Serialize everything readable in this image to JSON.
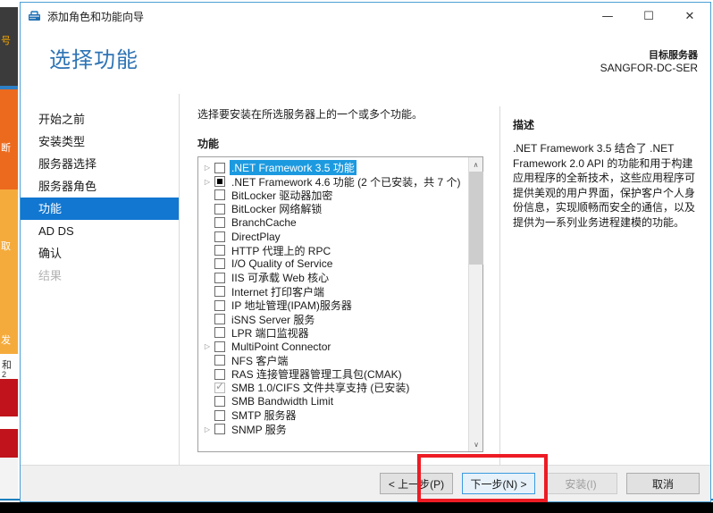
{
  "window": {
    "title": "添加角色和功能向导",
    "icon": "server-wizard-icon",
    "minimize": "—",
    "maximize": "☐",
    "close": "✕"
  },
  "header": {
    "page_title": "选择功能",
    "target_label": "目标服务器",
    "target_name": "SANGFOR-DC-SER"
  },
  "nav": {
    "items": [
      {
        "label": "开始之前",
        "state": "normal"
      },
      {
        "label": "安装类型",
        "state": "normal"
      },
      {
        "label": "服务器选择",
        "state": "normal"
      },
      {
        "label": "服务器角色",
        "state": "normal"
      },
      {
        "label": "功能",
        "state": "selected"
      },
      {
        "label": "AD DS",
        "state": "normal"
      },
      {
        "label": "确认",
        "state": "normal"
      },
      {
        "label": "结果",
        "state": "disabled"
      }
    ]
  },
  "main": {
    "instruction": "选择要安装在所选服务器上的一个或多个功能。",
    "features_label": "功能",
    "features": [
      {
        "label": ".NET Framework 3.5 功能",
        "checkbox": "unchecked",
        "expander": true,
        "selected": true
      },
      {
        "label": ".NET Framework 4.6 功能 (2 个已安装，共 7 个)",
        "checkbox": "partial",
        "expander": true,
        "selected": false
      },
      {
        "label": "BitLocker 驱动器加密",
        "checkbox": "unchecked",
        "expander": false,
        "selected": false
      },
      {
        "label": "BitLocker 网络解锁",
        "checkbox": "unchecked",
        "expander": false,
        "selected": false
      },
      {
        "label": "BranchCache",
        "checkbox": "unchecked",
        "expander": false,
        "selected": false
      },
      {
        "label": "DirectPlay",
        "checkbox": "unchecked",
        "expander": false,
        "selected": false
      },
      {
        "label": "HTTP 代理上的 RPC",
        "checkbox": "unchecked",
        "expander": false,
        "selected": false
      },
      {
        "label": "I/O Quality of Service",
        "checkbox": "unchecked",
        "expander": false,
        "selected": false
      },
      {
        "label": "IIS 可承载 Web 核心",
        "checkbox": "unchecked",
        "expander": false,
        "selected": false
      },
      {
        "label": "Internet 打印客户端",
        "checkbox": "unchecked",
        "expander": false,
        "selected": false
      },
      {
        "label": "IP 地址管理(IPAM)服务器",
        "checkbox": "unchecked",
        "expander": false,
        "selected": false
      },
      {
        "label": "iSNS Server 服务",
        "checkbox": "unchecked",
        "expander": false,
        "selected": false
      },
      {
        "label": "LPR 端口监视器",
        "checkbox": "unchecked",
        "expander": false,
        "selected": false
      },
      {
        "label": "MultiPoint Connector",
        "checkbox": "unchecked",
        "expander": true,
        "selected": false
      },
      {
        "label": "NFS 客户端",
        "checkbox": "unchecked",
        "expander": false,
        "selected": false
      },
      {
        "label": "RAS 连接管理器管理工具包(CMAK)",
        "checkbox": "unchecked",
        "expander": false,
        "selected": false
      },
      {
        "label": "SMB 1.0/CIFS 文件共享支持 (已安装)",
        "checkbox": "installed",
        "expander": false,
        "selected": false
      },
      {
        "label": "SMB Bandwidth Limit",
        "checkbox": "unchecked",
        "expander": false,
        "selected": false
      },
      {
        "label": "SMTP 服务器",
        "checkbox": "unchecked",
        "expander": false,
        "selected": false
      },
      {
        "label": "SNMP 服务",
        "checkbox": "unchecked",
        "expander": true,
        "selected": false
      }
    ],
    "scroll_up": "∧",
    "scroll_down": "∨"
  },
  "description": {
    "title": "描述",
    "text": ".NET Framework 3.5 结合了 .NET Framework 2.0 API 的功能和用于构建应用程序的全新技术，这些应用程序可提供美观的用户界面，保护客户个人身份信息，实现顺畅而安全的通信，以及提供为一系列业务进程建模的功能。"
  },
  "footer": {
    "previous": "< 上一步(P)",
    "next": "下一步(N) >",
    "install": "安装(I)",
    "cancel": "取消"
  },
  "annotation": {
    "color": "#ed1c24",
    "target": "next-button"
  },
  "colors": {
    "accent_blue": "#1177d1",
    "title_blue": "#2e74b5",
    "selection_blue": "#1c9ae0",
    "footer_gray": "#f0f0f0",
    "annotation_red": "#ed1c24"
  }
}
